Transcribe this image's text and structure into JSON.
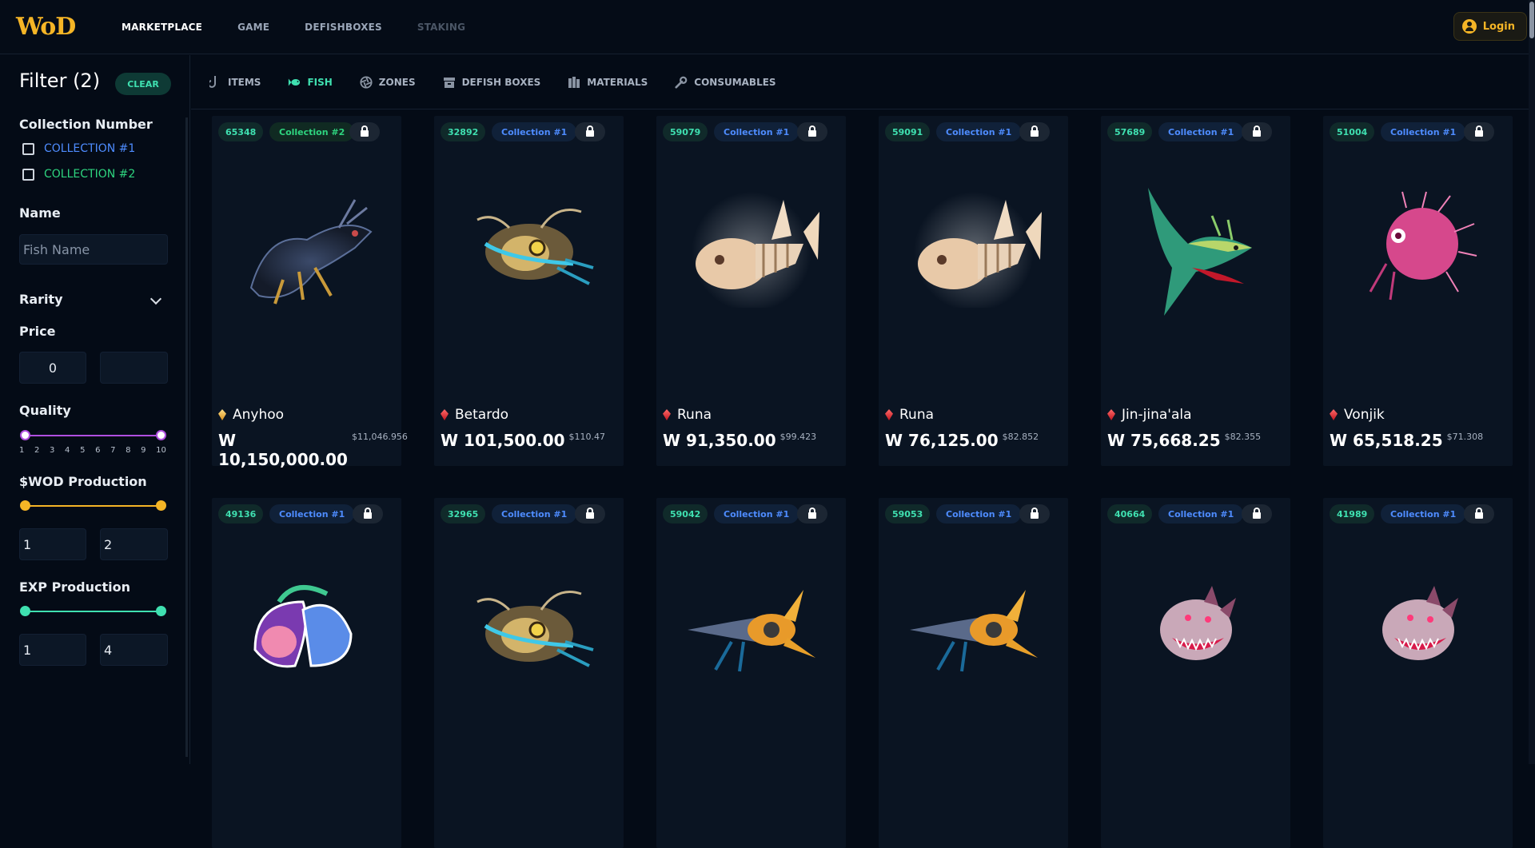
{
  "nav": {
    "logo": "WoD",
    "links": [
      "MARKETPLACE",
      "GAME",
      "DEFISHBOXES",
      "STAKING"
    ],
    "login": "Login"
  },
  "sidebar": {
    "title": "Filter (2)",
    "clear": "CLEAR",
    "collection_title": "Collection Number",
    "collections": [
      "COLLECTION #1",
      "COLLECTION #2"
    ],
    "name_title": "Name",
    "name_placeholder": "Fish Name",
    "rarity_title": "Rarity",
    "price_title": "Price",
    "price_min": "0",
    "price_max": "",
    "quality_title": "Quality",
    "quality_ticks": [
      "1",
      "2",
      "3",
      "4",
      "5",
      "6",
      "7",
      "8",
      "9",
      "10"
    ],
    "quality_range": [
      1,
      10
    ],
    "wod_title": "$WOD Production",
    "wod_min": "1",
    "wod_max": "2",
    "exp_title": "EXP Production",
    "exp_min": "1",
    "exp_max": "4"
  },
  "categories": [
    "ITEMS",
    "FISH",
    "ZONES",
    "DEFISH BOXES",
    "MATERIALS",
    "CONSUMABLES"
  ],
  "active_category": "FISH",
  "colors": {
    "accent": "#3fe0b0",
    "gold": "#f5b526",
    "collection1": "#4e8cff",
    "collection2": "#2ed47f",
    "quality": "#b04fe0"
  },
  "cards": [
    {
      "id": "65348",
      "collection": "Collection #2",
      "col": 2,
      "name": "Anyhoo",
      "gem": "gold",
      "price": "W 10,150,000.00",
      "usd": "$11,046.956",
      "art": "dark-anglerfish"
    },
    {
      "id": "32892",
      "collection": "Collection #1",
      "col": 1,
      "name": "Betardo",
      "gem": "red",
      "price": "W 101,500.00",
      "usd": "$110.47",
      "art": "lantern-fish"
    },
    {
      "id": "59079",
      "collection": "Collection #1",
      "col": 1,
      "name": "Runa",
      "gem": "red",
      "price": "W 91,350.00",
      "usd": "$99.423",
      "art": "bone-fish"
    },
    {
      "id": "59091",
      "collection": "Collection #1",
      "col": 1,
      "name": "Runa",
      "gem": "red",
      "price": "W 76,125.00",
      "usd": "$82.852",
      "art": "bone-fish"
    },
    {
      "id": "57689",
      "collection": "Collection #1",
      "col": 1,
      "name": "Jin-jina'ala",
      "gem": "red",
      "price": "W 75,668.25",
      "usd": "$82.355",
      "art": "green-shark"
    },
    {
      "id": "51004",
      "collection": "Collection #1",
      "col": 1,
      "name": "Vonjik",
      "gem": "red",
      "price": "W 65,518.25",
      "usd": "$71.308",
      "art": "pink-puff"
    },
    {
      "id": "49136",
      "collection": "Collection #1",
      "col": 1,
      "name": "",
      "gem": "",
      "price": "",
      "usd": "",
      "art": "shell-creature"
    },
    {
      "id": "32965",
      "collection": "Collection #1",
      "col": 1,
      "name": "",
      "gem": "",
      "price": "",
      "usd": "",
      "art": "lantern-fish"
    },
    {
      "id": "59042",
      "collection": "Collection #1",
      "col": 1,
      "name": "",
      "gem": "",
      "price": "",
      "usd": "",
      "art": "rocket-fish"
    },
    {
      "id": "59053",
      "collection": "Collection #1",
      "col": 1,
      "name": "",
      "gem": "",
      "price": "",
      "usd": "",
      "art": "rocket-fish"
    },
    {
      "id": "40664",
      "collection": "Collection #1",
      "col": 1,
      "name": "",
      "gem": "",
      "price": "",
      "usd": "",
      "art": "spiky-piranha"
    },
    {
      "id": "41989",
      "collection": "Collection #1",
      "col": 1,
      "name": "",
      "gem": "",
      "price": "",
      "usd": "",
      "art": "spiky-piranha"
    }
  ]
}
